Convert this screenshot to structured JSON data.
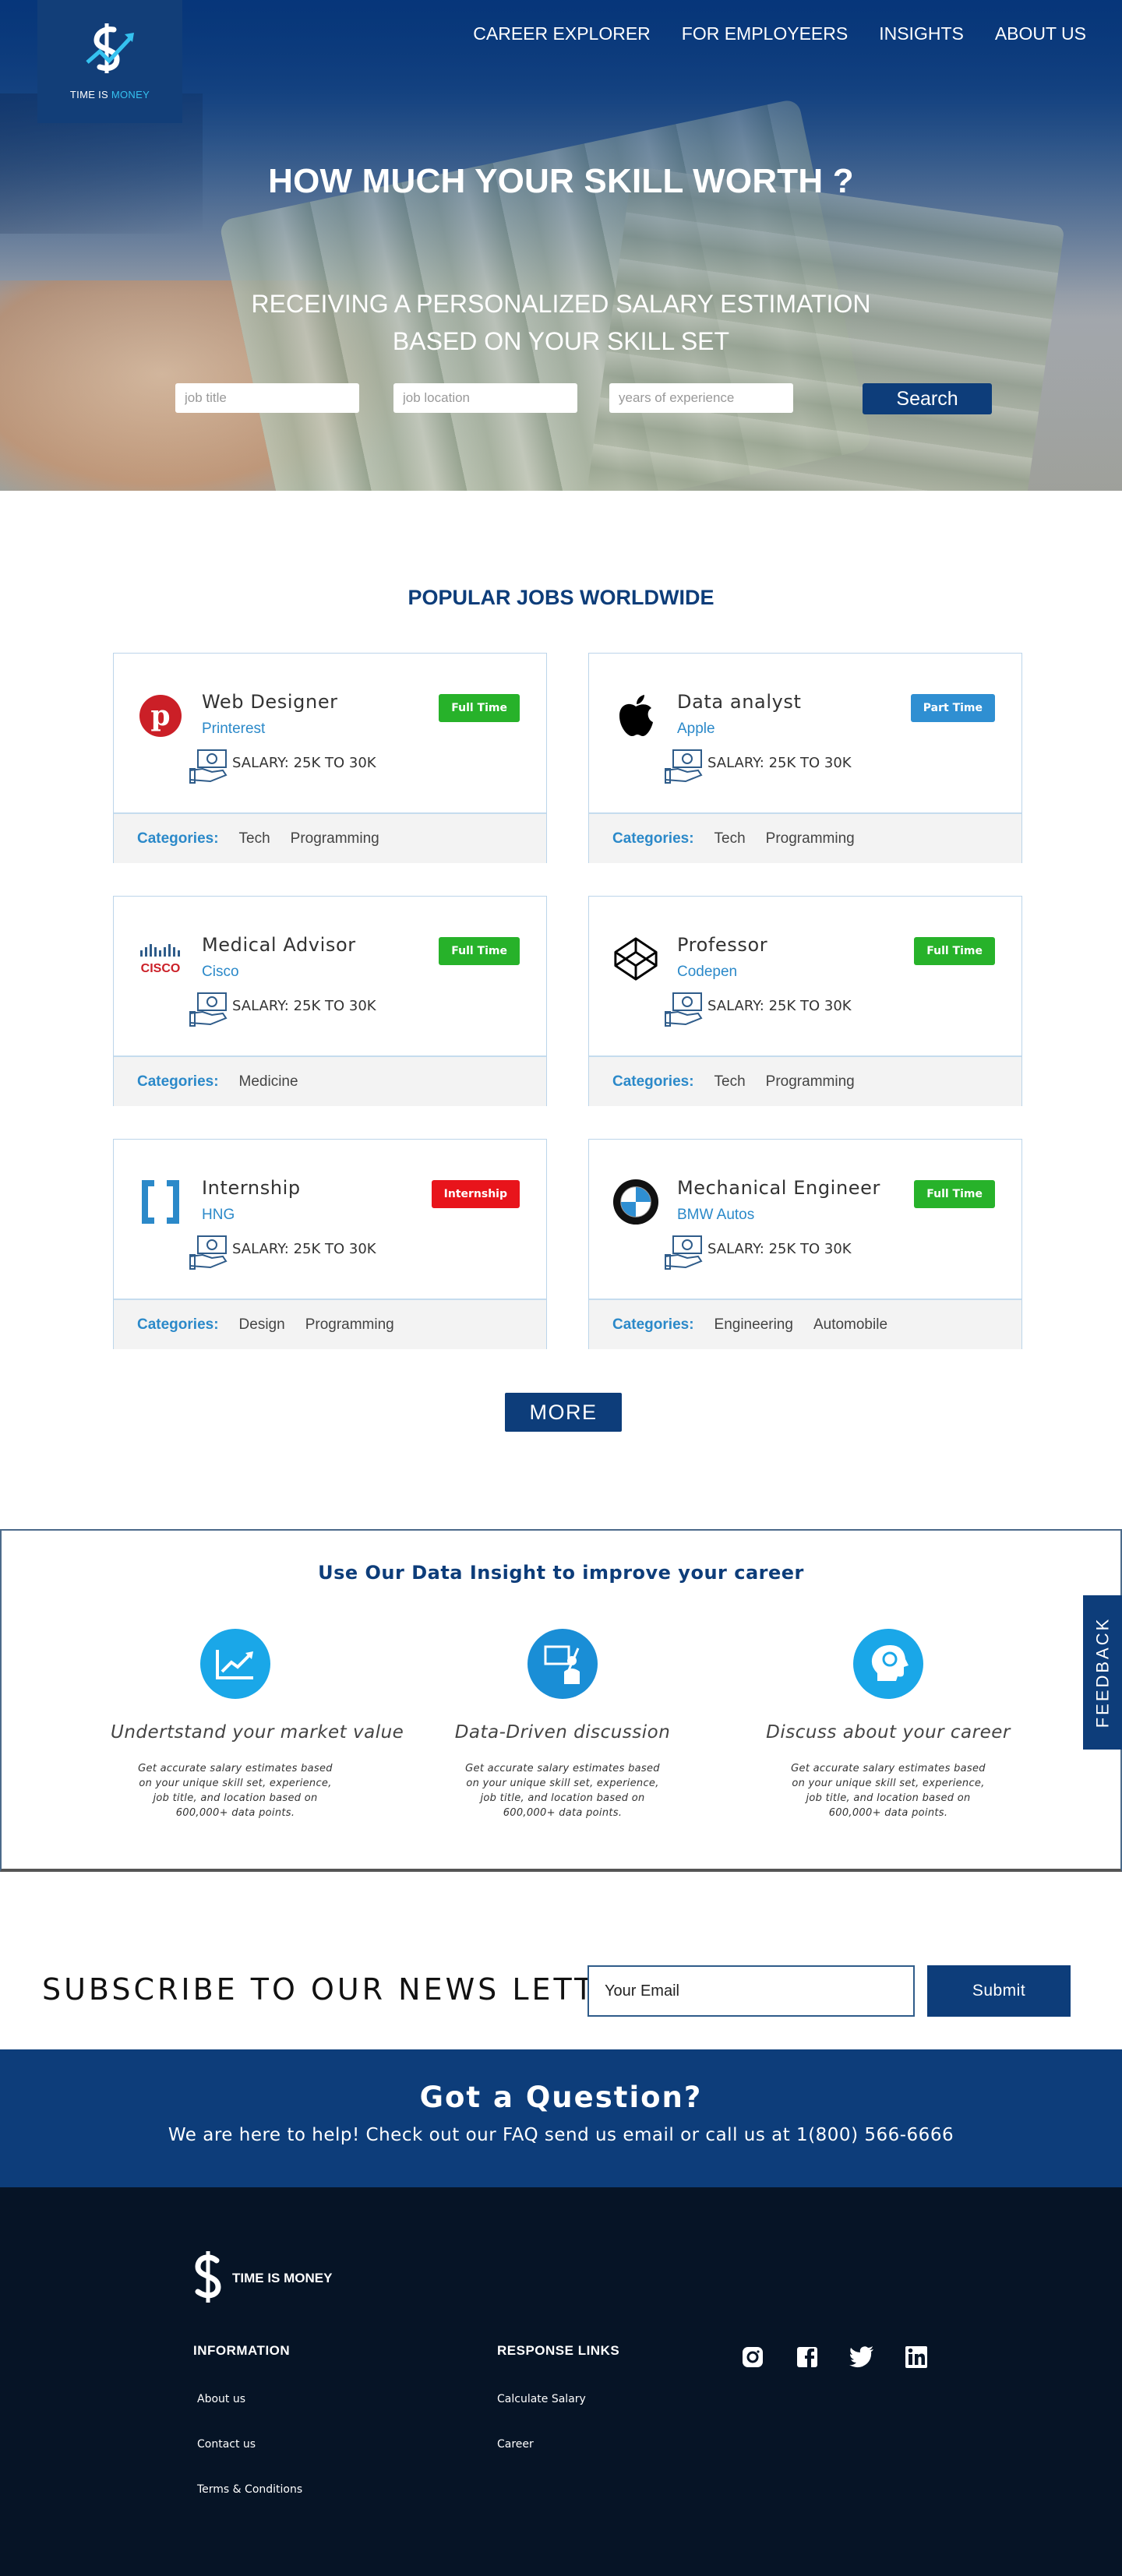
{
  "brand": {
    "logo_text_main": "TIME IS ",
    "logo_text_accent": "MONEY",
    "footer_logo_text": "TIME IS MONEY"
  },
  "nav": [
    "CAREER EXPLORER",
    "FOR EMPLOYEERS",
    "INSIGHTS",
    "ABOUT US"
  ],
  "hero": {
    "title": "HOW MUCH YOUR SKILL WORTH ?",
    "subtitle_line1": "RECEIVING A PERSONALIZED SALARY ESTIMATION",
    "subtitle_line2": "BASED ON YOUR SKILL SET",
    "search": {
      "job_title_placeholder": "job title",
      "job_location_placeholder": "job location",
      "experience_placeholder": "years of experience",
      "button_label": "Search"
    }
  },
  "jobs": {
    "title": "POPULAR JOBS WORLDWIDE",
    "categories_label": "Categories:",
    "items": [
      {
        "title": "Web Designer",
        "company": "Printerest",
        "salary": "SALARY: 25K TO 30K",
        "badge": "Full Time",
        "badge_type": "full",
        "logo": "pinterest-logo-icon",
        "categories": [
          "Tech",
          "Programming"
        ]
      },
      {
        "title": "Data analyst",
        "company": "Apple",
        "salary": "SALARY: 25K TO 30K",
        "badge": "Part Time",
        "badge_type": "part",
        "logo": "apple-logo-icon",
        "categories": [
          "Tech",
          "Programming"
        ]
      },
      {
        "title": "Medical Advisor",
        "company": "Cisco",
        "salary": "SALARY: 25K TO 30K",
        "badge": "Full Time",
        "badge_type": "full",
        "logo": "cisco-logo-icon",
        "categories": [
          "Medicine"
        ]
      },
      {
        "title": "Professor",
        "company": "Codepen",
        "salary": "SALARY: 25K TO 30K",
        "badge": "Full Time",
        "badge_type": "full",
        "logo": "codepen-logo-icon",
        "categories": [
          "Tech",
          "Programming"
        ]
      },
      {
        "title": "Internship",
        "company": "HNG",
        "salary": "SALARY: 25K TO 30K",
        "badge": "Internship",
        "badge_type": "intern",
        "logo": "hng-logo-icon",
        "categories": [
          "Design",
          "Programming"
        ]
      },
      {
        "title": "Mechanical Engineer",
        "company": "BMW Autos",
        "salary": "SALARY: 25K TO 30K",
        "badge": "Full Time",
        "badge_type": "full",
        "logo": "bmw-logo-icon",
        "categories": [
          "Engineering",
          "Automobile"
        ]
      }
    ],
    "more_label": "MORE"
  },
  "insight": {
    "title": "Use Our Data Insight to improve your career",
    "features": [
      {
        "heading": "Undertstand your market value",
        "desc": "Get accurate salary estimates based on your unique skill set, experience, job title, and location based on 600,000+ data points.",
        "icon": "chart-icon"
      },
      {
        "heading": "Data-Driven discussion",
        "desc": "Get accurate salary estimates based on your unique skill set, experience, job title, and location based on 600,000+ data points.",
        "icon": "presenter-icon"
      },
      {
        "heading": "Discuss about your career",
        "desc": "Get accurate salary estimates based on your unique skill set, experience, job title, and location based on 600,000+ data points.",
        "icon": "head-icon"
      }
    ]
  },
  "feedback_label": "FEEDBACK",
  "subscribe": {
    "title": "SUBSCRIBE TO OUR NEWS LETTER",
    "email_placeholder": "Your Email",
    "button_label": "Submit"
  },
  "question": {
    "title": "Got a Question?",
    "text": "We are here to help! Check out our FAQ send us email or call us at 1(800) 566-6666"
  },
  "footer": {
    "information_heading": "INFORMATION",
    "information_links": [
      "About us",
      "Contact us",
      "Terms & Conditions"
    ],
    "response_heading": "RESPONSE LINKS",
    "response_links": [
      "Calculate Salary",
      "Career"
    ],
    "social": [
      "instagram-icon",
      "facebook-icon",
      "twitter-icon",
      "linkedin-icon"
    ]
  },
  "colors": {
    "primary": "#0d3d7a",
    "accent": "#2b89c9",
    "full_time": "#27b22a",
    "part_time": "#2f8fd2",
    "internship": "#e8141b",
    "footer_bg": "#061426"
  }
}
